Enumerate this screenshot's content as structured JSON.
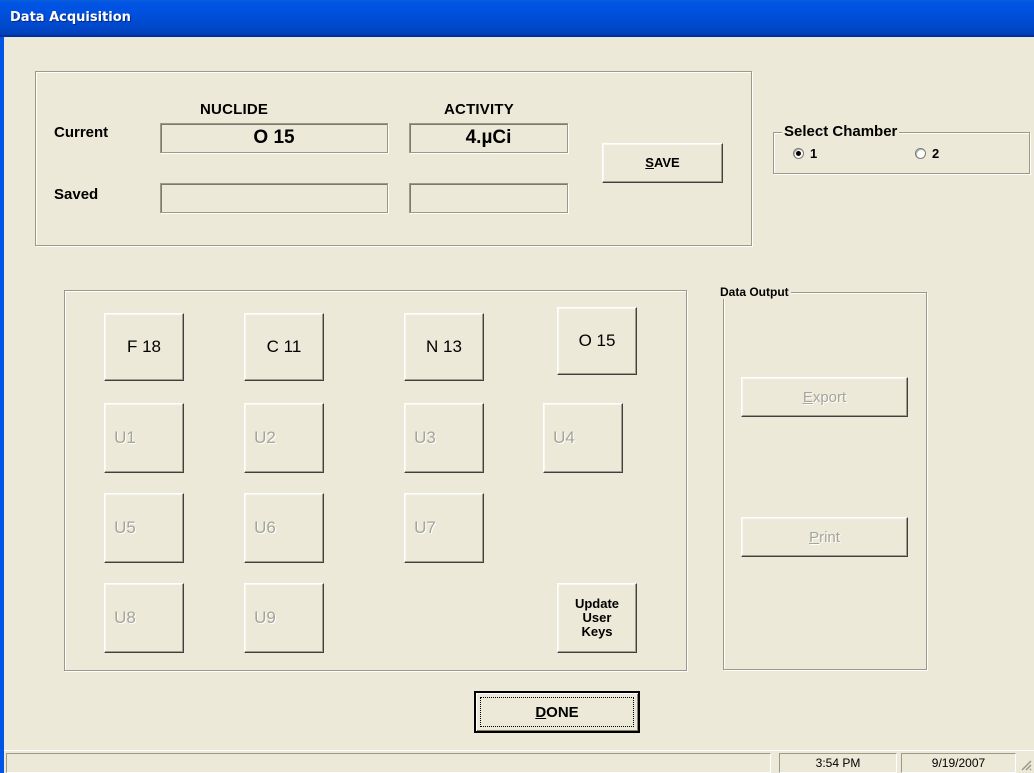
{
  "window": {
    "title": "Data Acquisition"
  },
  "readings": {
    "nuclide_header": "NUCLIDE",
    "activity_header": "ACTIVITY",
    "current_label": "Current",
    "saved_label": "Saved",
    "current_nuclide": "O 15",
    "current_activity": "4.µCi",
    "saved_nuclide": "",
    "saved_activity": "",
    "save_button": {
      "pre": "",
      "accel": "S",
      "post": "AVE"
    }
  },
  "chamber": {
    "label": "Select Chamber",
    "options": [
      {
        "label": "1",
        "selected": true
      },
      {
        "label": "2",
        "selected": false
      }
    ]
  },
  "nuclide_keys": [
    {
      "label": "F 18",
      "enabled": true
    },
    {
      "label": "C 11",
      "enabled": true
    },
    {
      "label": "N 13",
      "enabled": true
    },
    {
      "label": "O 15",
      "enabled": true
    },
    {
      "label": "U1",
      "enabled": false
    },
    {
      "label": "U2",
      "enabled": false
    },
    {
      "label": "U3",
      "enabled": false
    },
    {
      "label": "U4",
      "enabled": false
    },
    {
      "label": "U5",
      "enabled": false
    },
    {
      "label": "U6",
      "enabled": false
    },
    {
      "label": "U7",
      "enabled": false
    },
    {
      "label": "U8",
      "enabled": false
    },
    {
      "label": "U9",
      "enabled": false
    }
  ],
  "update_keys_button": {
    "line1": "Update",
    "line2": "User",
    "line3": "Keys"
  },
  "data_output": {
    "label": "Data Output",
    "export_button": {
      "accel": "E",
      "rest": "xport",
      "enabled": false
    },
    "print_button": {
      "accel": "P",
      "rest": "rint",
      "enabled": false
    }
  },
  "done_button": {
    "accel": "D",
    "rest": "ONE"
  },
  "statusbar": {
    "time": "3:54 PM",
    "date": "9/19/2007"
  },
  "colors": {
    "titlebar": "#0054e3",
    "window_bg": "#ece9d8",
    "disabled_text": "#a4a49a"
  }
}
